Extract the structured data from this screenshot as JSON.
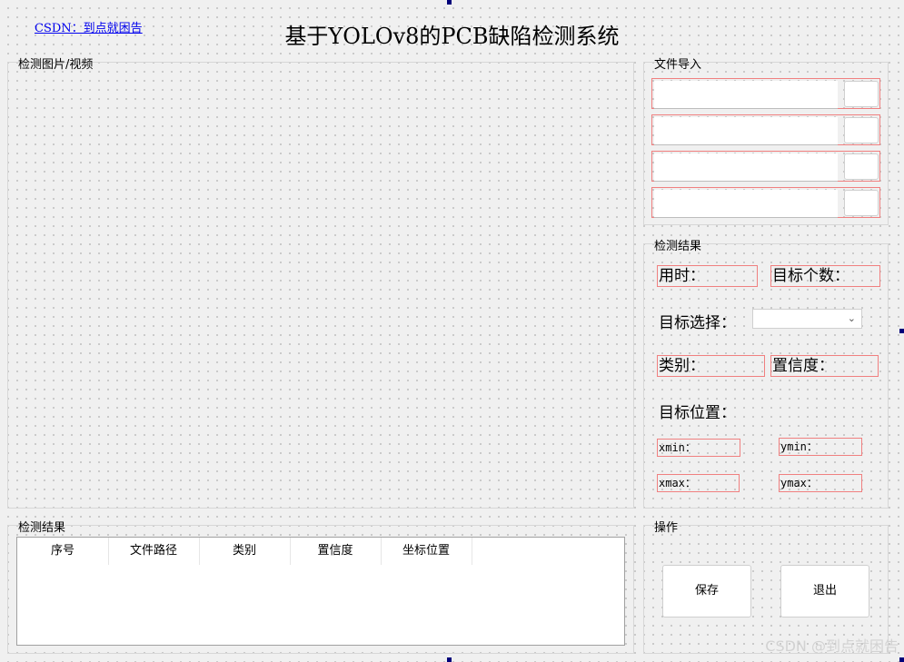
{
  "header": {
    "csdn_link": "CSDN：到点就困告",
    "title": "基于YOLOv8的PCB缺陷检测系统"
  },
  "display_panel": {
    "title": "检测图片/视频"
  },
  "file_import": {
    "title": "文件导入",
    "rows": [
      {
        "value": ""
      },
      {
        "value": ""
      },
      {
        "value": ""
      },
      {
        "value": ""
      }
    ]
  },
  "detect_result": {
    "title": "检测结果",
    "time_label": "用时：",
    "count_label": "目标个数：",
    "select_label": "目标选择：",
    "select_value": "",
    "class_label": "类别：",
    "conf_label": "置信度：",
    "position_label": "目标位置：",
    "xmin_label": "xmin：",
    "ymin_label": "ymin：",
    "xmax_label": "xmax：",
    "ymax_label": "ymax："
  },
  "result_table": {
    "title": "检测结果",
    "columns": [
      "序号",
      "文件路径",
      "类别",
      "置信度",
      "坐标位置"
    ],
    "rows": []
  },
  "operations": {
    "title": "操作",
    "save_label": "保存",
    "exit_label": "退出"
  },
  "watermark": "CSDN @到点就困告"
}
